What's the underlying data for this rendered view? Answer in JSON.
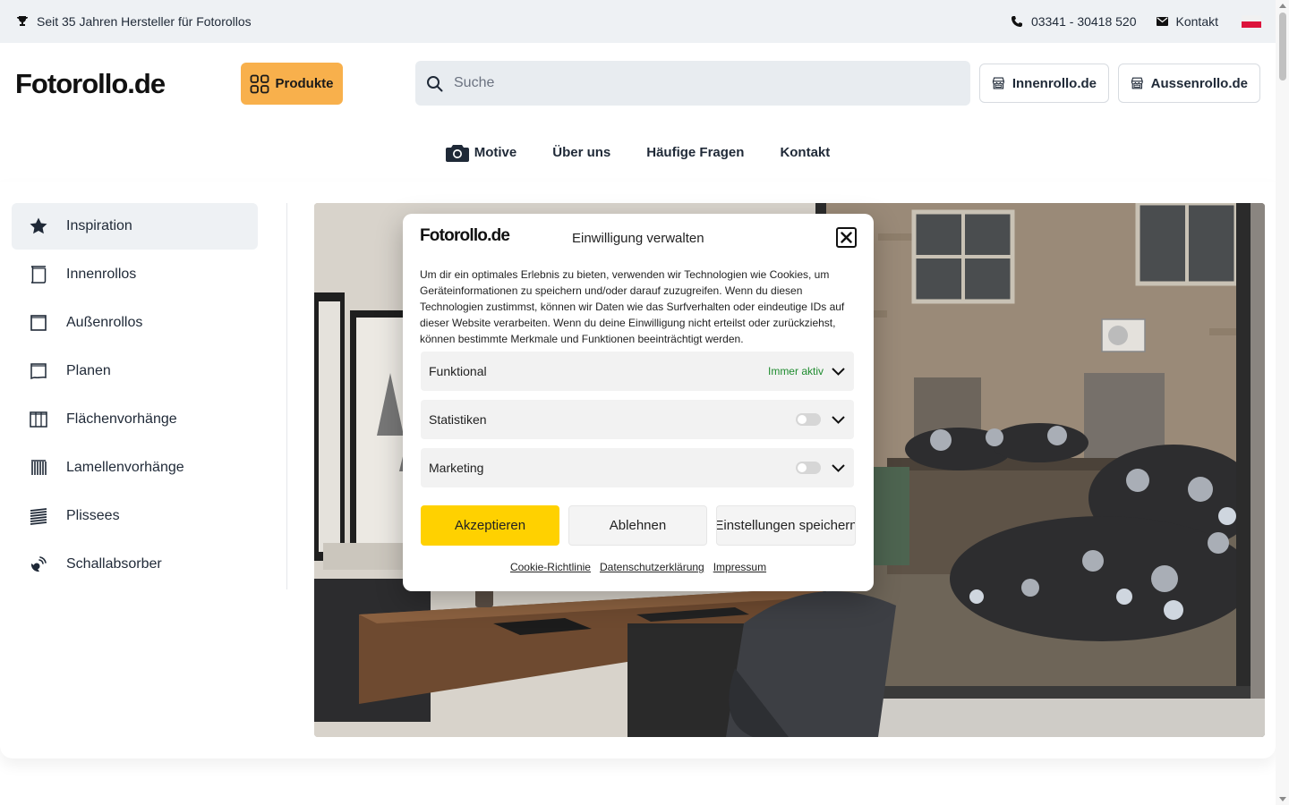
{
  "topbar": {
    "tagline": "Seit 35 Jahren Hersteller für Fotorollos",
    "phone": "03341 - 30418 520",
    "contact": "Kontakt",
    "trophy_icon": "trophy-icon",
    "phone_icon": "phone-icon",
    "mail_icon": "mail-icon",
    "flag_icon": "flag-poland-icon"
  },
  "header": {
    "logo_text": "Fotorollo.de",
    "produkte_label": "Produkte",
    "search_placeholder": "Suche",
    "shop_inner_label": "Innenrollo.de",
    "shop_outer_label": "Aussenrollo.de",
    "brand_color": "#f8b04c"
  },
  "nav": {
    "items": [
      {
        "label": "Motive",
        "icon": "camera-icon"
      },
      {
        "label": "Über uns"
      },
      {
        "label": "Häufige Fragen"
      },
      {
        "label": "Kontakt"
      }
    ]
  },
  "sidebar": {
    "items": [
      {
        "label": "Inspiration",
        "icon": "star-icon",
        "active": true
      },
      {
        "label": "Innenrollos",
        "icon": "roller-blind-icon"
      },
      {
        "label": "Außenrollos",
        "icon": "frame-icon"
      },
      {
        "label": "Planen",
        "icon": "tarp-icon"
      },
      {
        "label": "Flächenvorhänge",
        "icon": "panel-curtain-icon"
      },
      {
        "label": "Lamellenvorhänge",
        "icon": "vertical-blind-icon"
      },
      {
        "label": "Plissees",
        "icon": "pleated-blind-icon"
      },
      {
        "label": "Schallabsorber",
        "icon": "sound-absorber-icon"
      }
    ]
  },
  "consent": {
    "logo_text": "Fotorollo.de",
    "title": "Einwilligung verwalten",
    "description": "Um dir ein optimales Erlebnis zu bieten, verwenden wir Technologien wie Cookies, um Geräteinformationen zu speichern und/oder darauf zuzugreifen. Wenn du diesen Technologien zustimmst, können wir Daten wie das Surfverhalten oder eindeutige IDs auf dieser Website verarbeiten. Wenn du deine Einwilligung nicht erteilst oder zurückziehst, können bestimmte Merkmale und Funktionen beeinträchtigt werden.",
    "categories": [
      {
        "label": "Funktional",
        "status": "Immer aktiv"
      },
      {
        "label": "Statistiken",
        "enabled": false
      },
      {
        "label": "Marketing",
        "enabled": false
      }
    ],
    "accept_label": "Akzeptieren",
    "deny_label": "Ablehnen",
    "save_label": "Einstellungen speichern",
    "links": [
      "Cookie-Richtlinie",
      "Datenschutzerklärung",
      "Impressum"
    ],
    "accept_color": "#ffd100",
    "active_color": "#1e8b2e"
  }
}
